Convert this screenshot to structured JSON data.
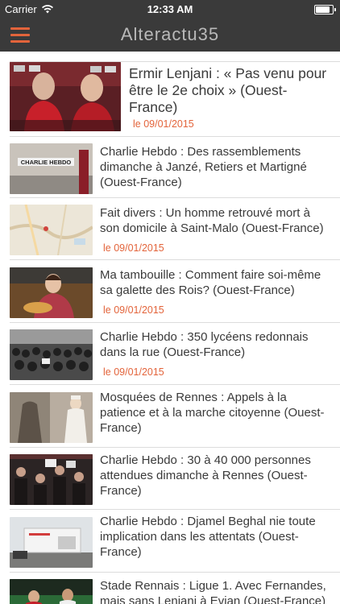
{
  "status": {
    "carrier": "Carrier",
    "time": "12:33 AM"
  },
  "header": {
    "title": "Alteractu35",
    "menu_icon": "hamburger-menu-icon"
  },
  "colors": {
    "accent": "#e3643b",
    "bar": "#3a3a3a",
    "title": "#3a3a3a",
    "separator": "#dcdcdc"
  },
  "articles": [
    {
      "title": "Ermir Lenjani : « Pas venu pour être le 2e choix » (Ouest-France)",
      "date": "le 09/01/2015",
      "thumb": "players-photo"
    },
    {
      "title": "Charlie Hebdo : Des rassemblements dimanche à Janzé, Retiers et Martigné (Ouest-France)",
      "date": "",
      "thumb": "charlie-hebdo-sign-photo"
    },
    {
      "title": "Fait divers : Un homme retrouvé mort à son domicile à Saint-Malo (Ouest-France)",
      "date": "le 09/01/2015",
      "thumb": "map-photo"
    },
    {
      "title": "Ma tambouille : Comment faire soi-même sa galette des Rois? (Ouest-France)",
      "date": "le 09/01/2015",
      "thumb": "cook-photo"
    },
    {
      "title": "Charlie Hebdo : 350 lycéens redonnais dans la rue (Ouest-France)",
      "date": "le 09/01/2015",
      "thumb": "crowd-photo"
    },
    {
      "title": "Mosquées de Rennes : Appels à la patience et à la marche citoyenne (Ouest-France)",
      "date": "",
      "thumb": "imam-photo"
    },
    {
      "title": "Charlie Hebdo : 30 à 40 000 personnes attendues dimanche à Rennes (Ouest-France)",
      "date": "",
      "thumb": "gathering-photo"
    },
    {
      "title": "Charlie Hebdo : Djamel Beghal nie toute implication dans les attentats (Ouest-France)",
      "date": "",
      "thumb": "building-photo"
    },
    {
      "title": "Stade Rennais : Ligue 1. Avec Fernandes, mais sans Lenjani à Evian (Ouest-France)",
      "date": "",
      "thumb": "football-photo"
    }
  ]
}
